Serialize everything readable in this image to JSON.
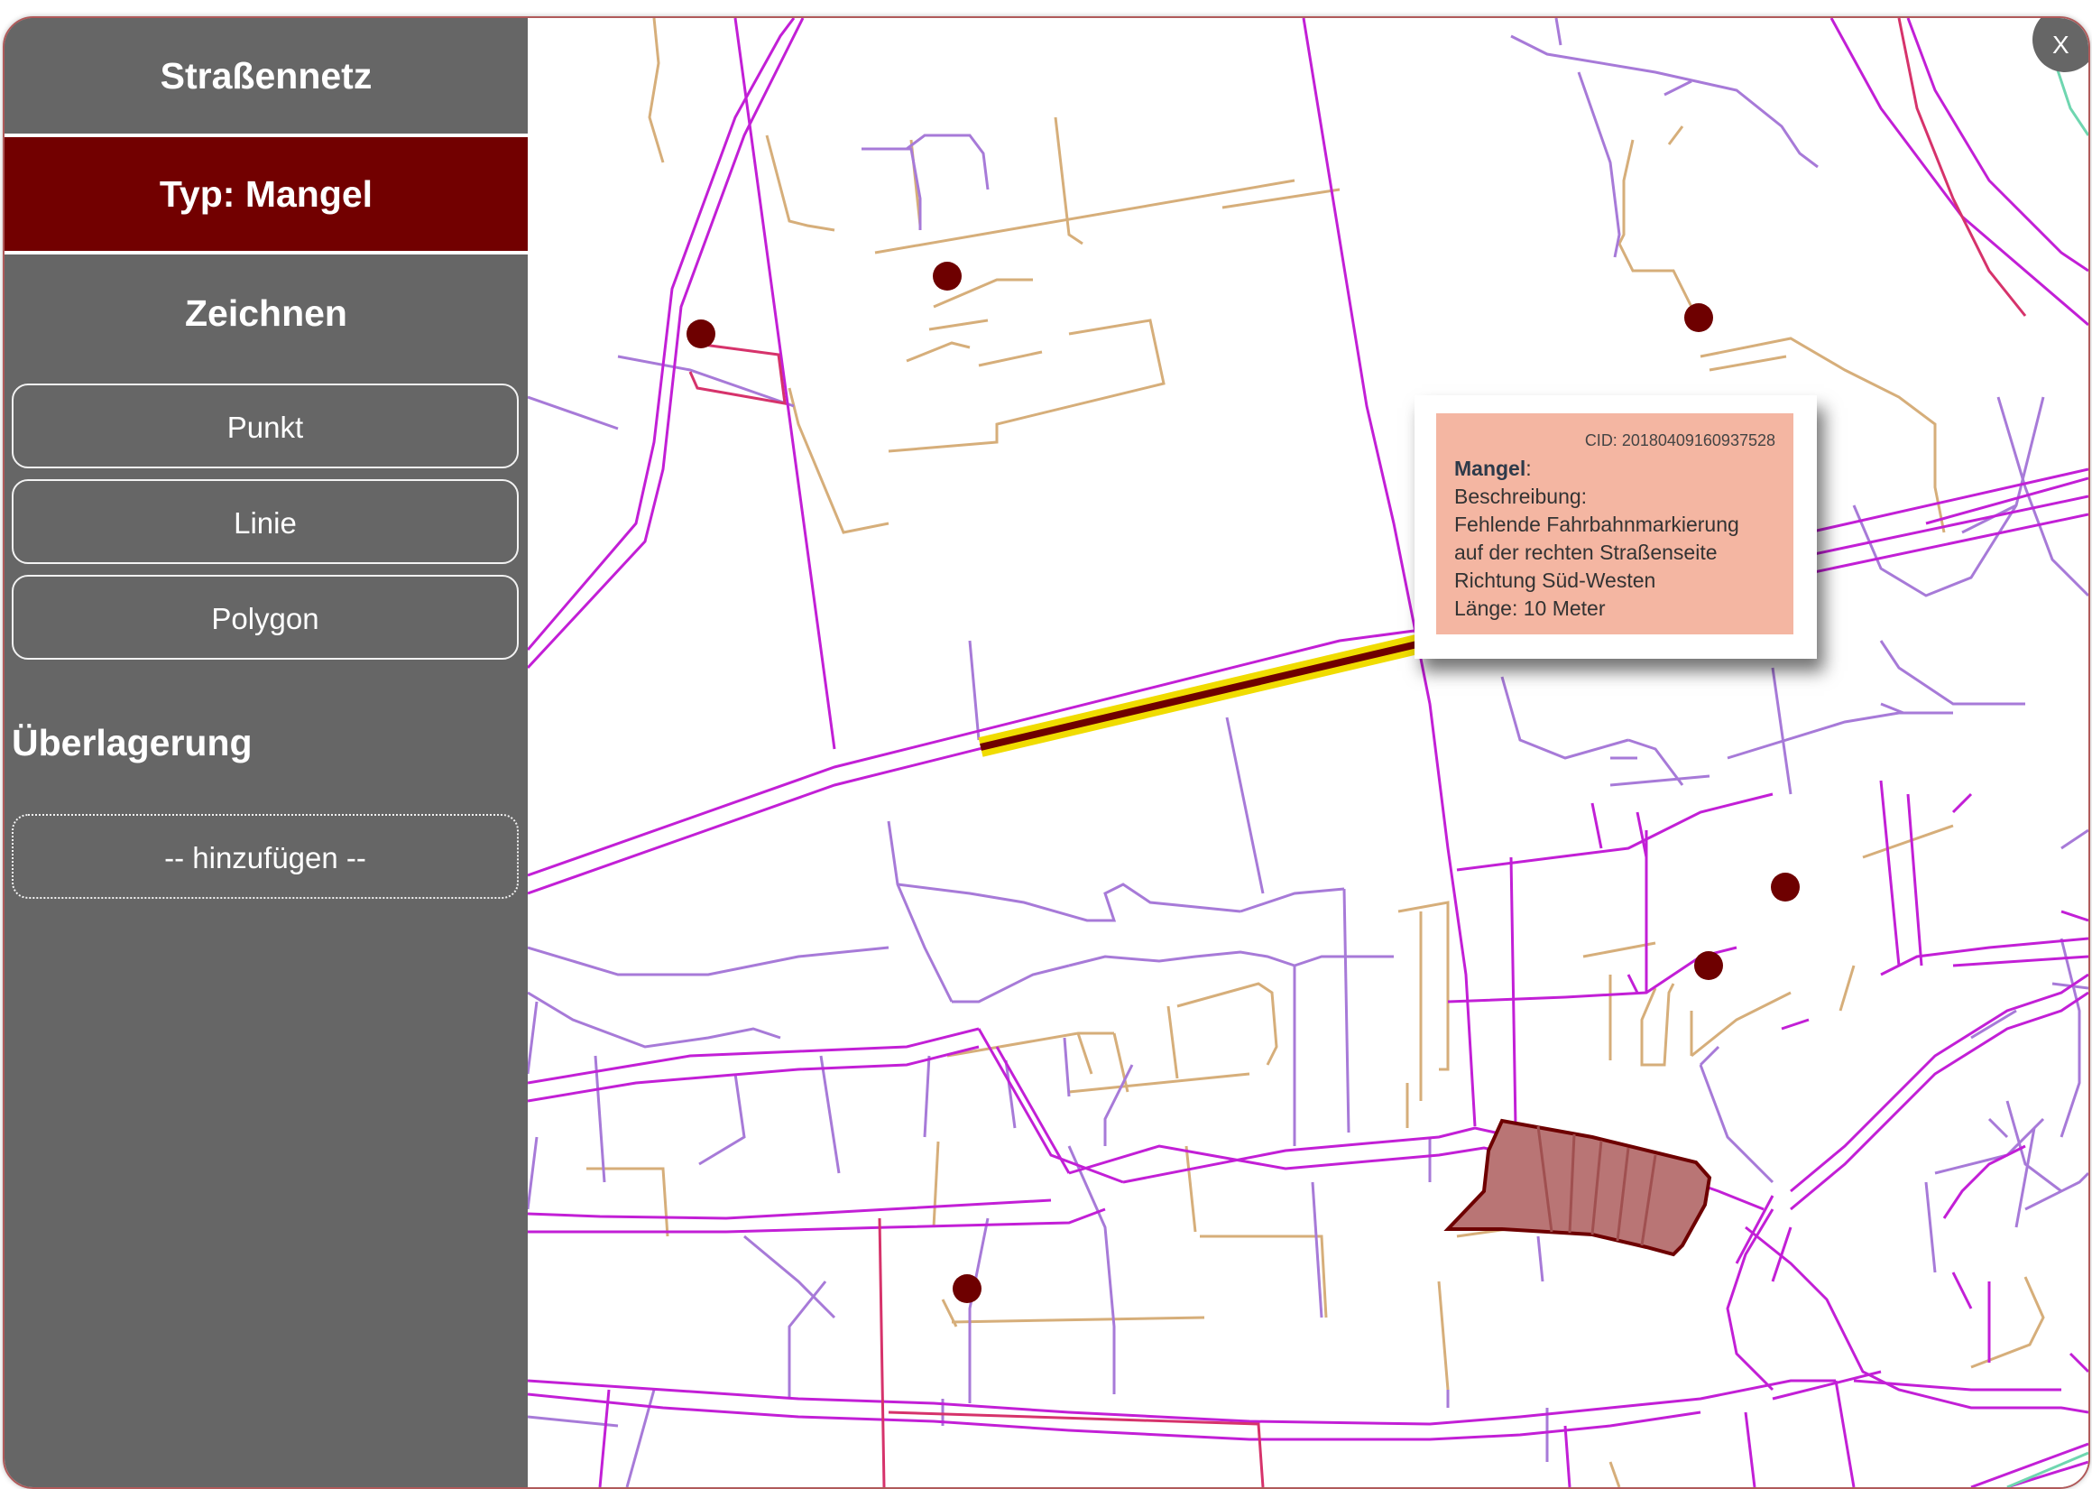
{
  "sidebar": {
    "network_title": "Straßennetz",
    "type_title": "Typ: Mangel",
    "draw_title": "Zeichnen",
    "draw_buttons": [
      {
        "label": "Punkt"
      },
      {
        "label": "Linie"
      },
      {
        "label": "Polygon"
      }
    ],
    "overlay_title": "Überlagerung",
    "overlay_add_label": "-- hinzufügen --"
  },
  "close": {
    "label": "X"
  },
  "popup": {
    "cid": "CID: 20180409160937528",
    "type_label": "Mangel",
    "type_suffix": ":",
    "description_label": "Beschreibung:",
    "description_lines": [
      "Fehlende Fahrbahnmarkierung",
      "auf der rechten Straßenseite",
      "Richtung Süd-Westen"
    ],
    "length": "Länge: 10 Meter"
  },
  "map": {
    "colors": {
      "main_road": "#c21fd6",
      "minor_road": "#a77ad8",
      "path": "#d6ae7a",
      "red_road": "#d6336b",
      "marker": "#6e0000",
      "highlight": "#f0dc00",
      "polygon_fill": "#b97575",
      "polygon_stroke": "#6e0000"
    }
  }
}
